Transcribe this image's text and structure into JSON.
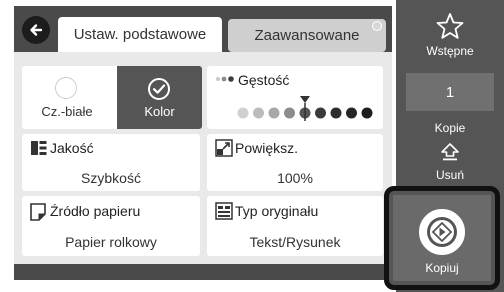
{
  "tabs": {
    "basic": "Ustaw. podstawowe",
    "advanced": "Zaawansowane"
  },
  "color_mode": {
    "mono_label": "Cz.-białe",
    "color_label": "Kolor",
    "selected": "Kolor"
  },
  "density": {
    "label": "Gęstość",
    "level": 4,
    "steps": 9
  },
  "quality": {
    "label": "Jakość",
    "value": "Szybkość"
  },
  "enlarge": {
    "label": "Powiększ.",
    "value": "100%"
  },
  "paper_source": {
    "label": "Źródło papieru",
    "value": "Papier rolkowy"
  },
  "original_type": {
    "label": "Typ oryginału",
    "value": "Tekst/Rysunek"
  },
  "sidebar": {
    "presets_label": "Wstępne",
    "copies_value": "1",
    "copies_label": "Kopie",
    "clear_label": "Usuń",
    "copy_label": "Kopiuj"
  },
  "icons": [
    "back-arrow-icon",
    "star-icon",
    "checkmark-icon",
    "density-icon",
    "quality-icon",
    "enlarge-icon",
    "paper-source-icon",
    "original-type-icon",
    "clear-icon",
    "start-icon"
  ],
  "colors": {
    "panel": "#555555",
    "tab_active": "#ffffff",
    "tab_inactive": "#cfcfcf",
    "content_bg": "#e9e9e9",
    "copy_frame": "#111111"
  }
}
